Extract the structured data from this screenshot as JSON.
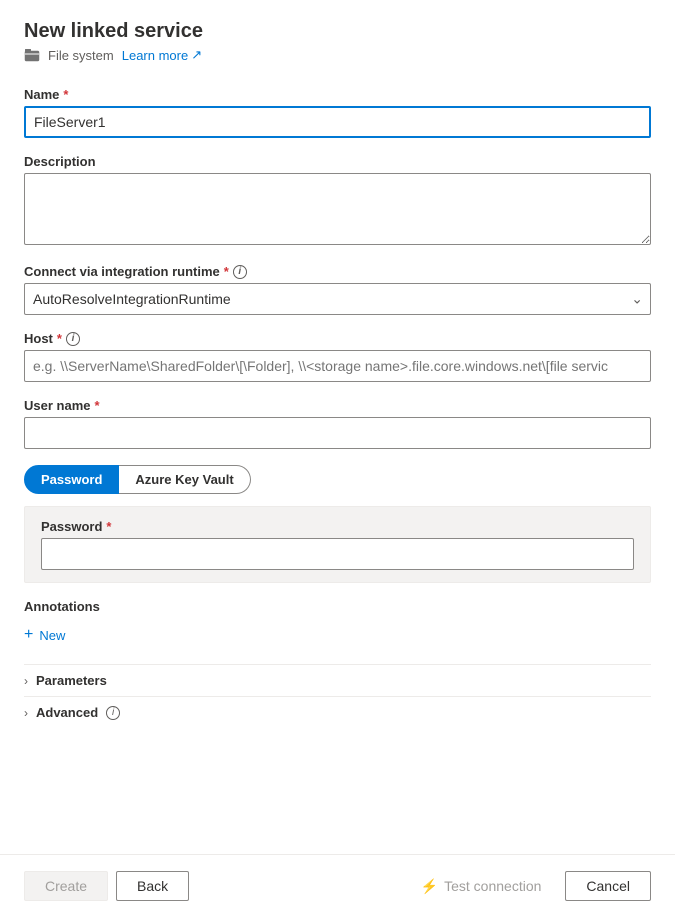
{
  "header": {
    "title": "New linked service",
    "icon": "file-system-icon",
    "subtitle": "File system",
    "learn_more": "Learn more"
  },
  "form": {
    "name_label": "Name",
    "name_value": "FileServer1",
    "name_placeholder": "",
    "description_label": "Description",
    "description_value": "",
    "description_placeholder": "",
    "integration_runtime_label": "Connect via integration runtime",
    "integration_runtime_value": "AutoResolveIntegrationRuntime",
    "integration_runtime_options": [
      "AutoResolveIntegrationRuntime"
    ],
    "host_label": "Host",
    "host_placeholder": "e.g. \\\\ServerName\\SharedFolder\\[\\Folder], \\\\<storage name>.file.core.windows.net\\[file servic",
    "host_value": "",
    "username_label": "User name",
    "username_value": "",
    "username_placeholder": "",
    "password_tab_label": "Password",
    "azure_key_vault_tab_label": "Azure Key Vault",
    "password_field_label": "Password",
    "password_value": "",
    "annotations_label": "Annotations",
    "add_new_label": "New",
    "parameters_label": "Parameters",
    "advanced_label": "Advanced"
  },
  "footer": {
    "create_label": "Create",
    "back_label": "Back",
    "test_connection_label": "Test connection",
    "cancel_label": "Cancel"
  },
  "icons": {
    "info": "i",
    "chevron_down": "⌄",
    "chevron_right": "›",
    "plus": "+",
    "external_link": "↗",
    "plug": "⚡"
  }
}
